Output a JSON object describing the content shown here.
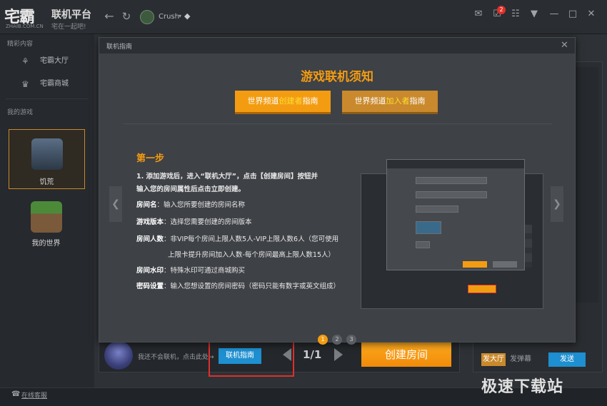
{
  "app": {
    "logo_mark": "宅霸",
    "logo_sub": "ZHAIB.COM.CN",
    "platform": "联机平台",
    "slogan": "宅在一起吧!",
    "user_name": "Crush",
    "notification_count": "2"
  },
  "sidebar": {
    "section_featured": "精彩内容",
    "items": [
      {
        "label": "宅霸大厅",
        "icon": "gamepad-icon"
      },
      {
        "label": "宅霸商城",
        "icon": "crown-icon"
      }
    ],
    "section_my_games": "我的游戏",
    "games": [
      {
        "label": "饥荒",
        "icon": "dont-starve-icon",
        "active": true
      },
      {
        "label": "我的世界",
        "icon": "minecraft-icon",
        "active": false
      }
    ]
  },
  "modal": {
    "title": "联机指南",
    "heading": "游戏联机须知",
    "tab_creator": {
      "prefix": "世界频道",
      "highlight": "创建者",
      "suffix": "指南"
    },
    "tab_joiner": {
      "prefix": "世界频道",
      "highlight": "加入者",
      "suffix": "指南"
    },
    "step_title": "第一步",
    "step_lines": [
      "1. 添加游戏后，进入“联机大厅”，点击【创建房间】按钮并",
      "输入您的房间属性后点击立即创建。"
    ],
    "fields": [
      {
        "name": "房间名",
        "desc": "：输入您所要创建的房间名称"
      },
      {
        "name": "游戏版本",
        "desc": "：选择您需要创建的房间版本"
      },
      {
        "name": "房间人数",
        "desc": "：非VIP每个房间上限人数5人-VIP上限人数6人（您可使用"
      },
      {
        "name": "",
        "desc": "上限卡提升房间加入人数-每个房间最高上限人数15人）"
      },
      {
        "name": "房间水印",
        "desc": "：特殊水印可通过商城购买"
      },
      {
        "name": "密码设置",
        "desc": "：输入您想设置的房间密码（密码只能有数字或英文组成）"
      }
    ],
    "pages": [
      "1",
      "2",
      "3"
    ]
  },
  "bottom": {
    "helper_text": "我还不会联机，点击此处→",
    "guide_button": "联机指南",
    "pager": "1/1",
    "create_room": "创建房间",
    "tab_hall": "发大厅",
    "tab_bullet": "发弹幕",
    "send": "发送",
    "online_service": "在线客服"
  },
  "watermark": {
    "text": "极速下载站"
  }
}
